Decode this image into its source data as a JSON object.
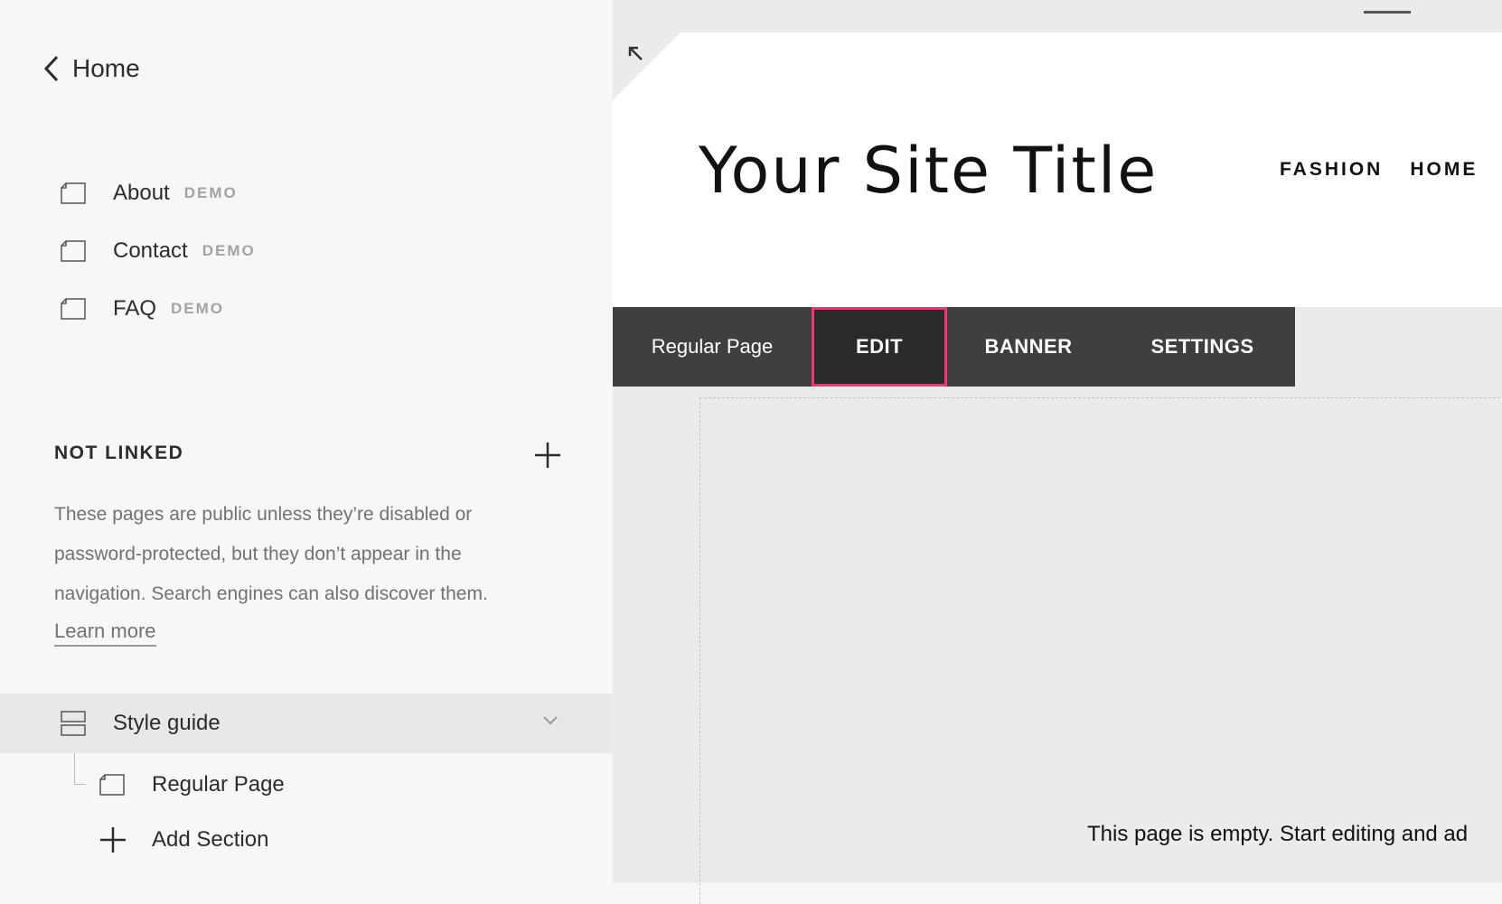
{
  "sidebar": {
    "back_label": "Home",
    "linked_pages": [
      {
        "label": "About",
        "badge": "DEMO"
      },
      {
        "label": "Contact",
        "badge": "DEMO"
      },
      {
        "label": "FAQ",
        "badge": "DEMO"
      }
    ],
    "not_linked": {
      "heading": "NOT LINKED",
      "description_lines": [
        "These pages are public unless they’re disabled or",
        "password-protected, but they don’t appear in the",
        "navigation. Search engines can also discover them."
      ],
      "learn_more": "Learn more"
    },
    "folder": {
      "label": "Style guide",
      "children": [
        {
          "label": "Regular Page"
        }
      ],
      "add_section": "Add Section"
    }
  },
  "preview": {
    "site_title": "Your Site Title",
    "nav": [
      "FASHION",
      "HOME"
    ],
    "toolbar": {
      "page_name": "Regular Page",
      "edit": "EDIT",
      "banner": "BANNER",
      "settings": "SETTINGS"
    },
    "empty_message": "This page is empty. Start editing and ad"
  },
  "colors": {
    "accent_highlight": "#e5397a",
    "toolbar_bg": "#3f3f3f",
    "sidebar_bg": "#f7f7f7"
  },
  "icons": {
    "back": "chevron-left-icon",
    "page": "page-icon",
    "add": "plus-icon",
    "folder": "folder-icon",
    "expand": "expand-arrow-icon",
    "chevron": "chevron-down-icon"
  }
}
